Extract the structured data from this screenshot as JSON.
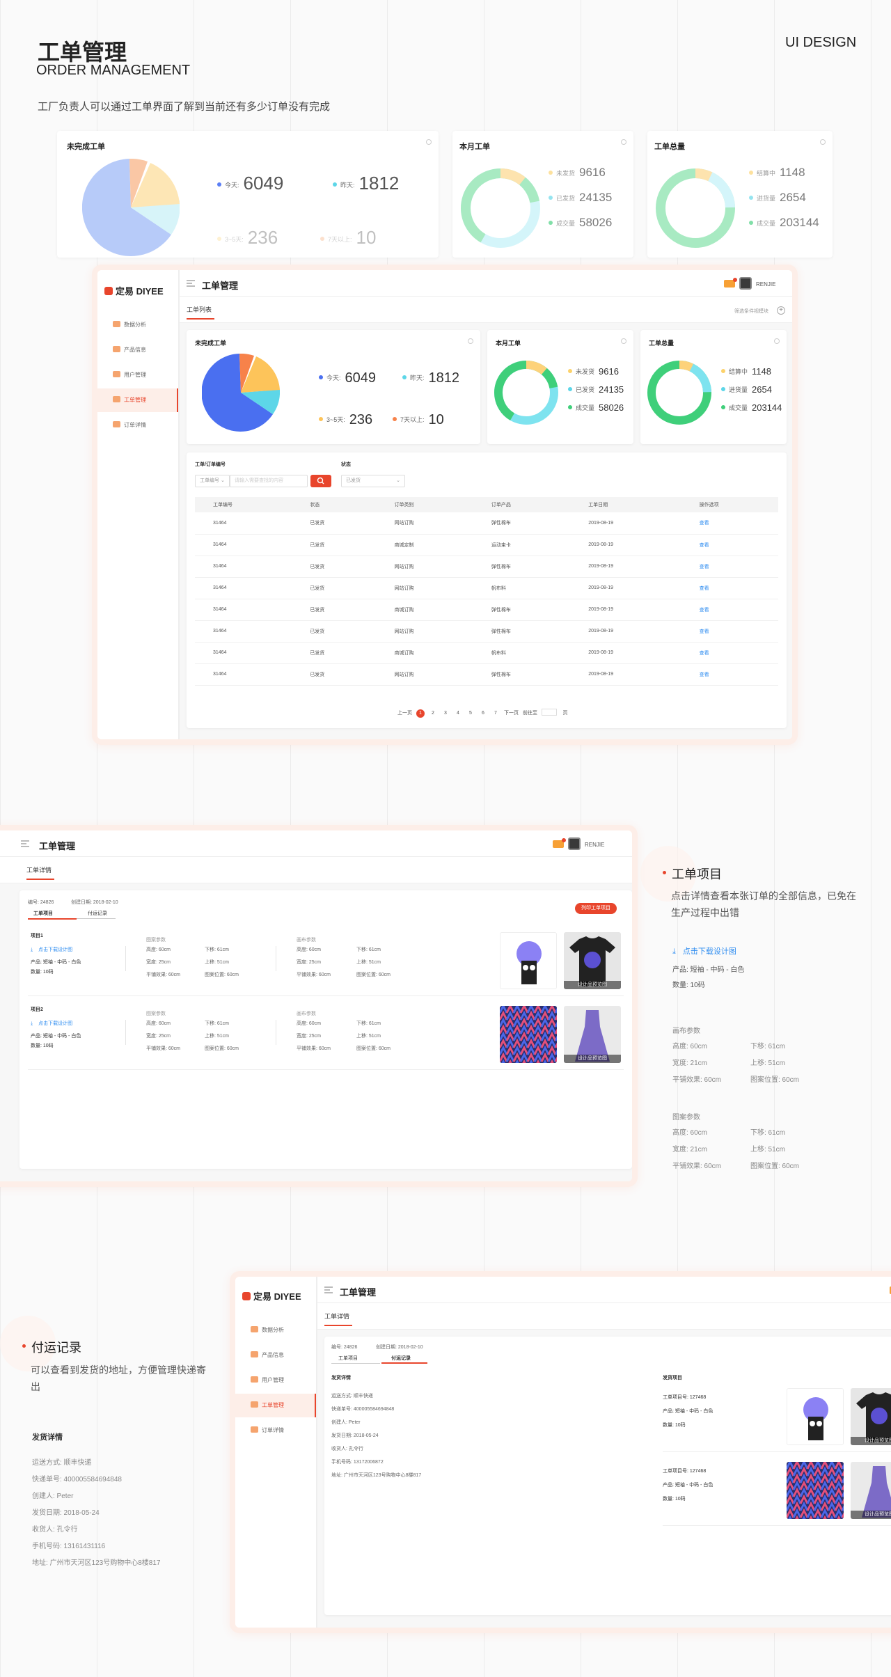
{
  "header": {
    "title_cn": "工单管理",
    "title_en": "ORDER MANAGEMENT",
    "ui_design": "UI DESIGN",
    "desc": "工厂负责人可以通过工单界面了解到当前还有多少订单没有完成"
  },
  "stats": {
    "unfinished_title": "未完成工单",
    "month_title": "本月工单",
    "total_title": "工单总量",
    "today_label": "今天:",
    "today_value": "6049",
    "yesterday_label": "昨天:",
    "yesterday_value": "1812",
    "d3_5_label": "3~5天:",
    "d3_5_value": "236",
    "d7_label": "7天以上:",
    "d7_value": "10",
    "month_items": [
      {
        "label": "未发货",
        "value": "9616",
        "color": "#fcd26b"
      },
      {
        "label": "已发货",
        "value": "24135",
        "color": "#5dd6e8"
      },
      {
        "label": "成交量",
        "value": "58026",
        "color": "#3fcf7a"
      }
    ],
    "total_items": [
      {
        "label": "结算中",
        "value": "1148",
        "color": "#fcd26b"
      },
      {
        "label": "进货量",
        "value": "2654",
        "color": "#5dd6e8"
      },
      {
        "label": "成交量",
        "value": "203144",
        "color": "#3fcf7a"
      }
    ]
  },
  "colors": {
    "accent": "#e8452c",
    "link": "#2d8cf0"
  },
  "app": {
    "logo": "定易 DIYEE",
    "page_title": "工单管理",
    "username": "RENJIE",
    "nav": [
      "数据分析",
      "产品信息",
      "用户管理",
      "工单管理",
      "订单详情"
    ],
    "tab_list": "工单列表",
    "filter_link": "筛选条件视模块",
    "search_label": "工单/订单编号",
    "status_label": "状态",
    "search_select": "工单编号",
    "search_placeholder": "请输入需要查找的内容",
    "status_select": "已发货",
    "columns": [
      "工单编号",
      "状态",
      "订单类别",
      "订单产品",
      "工单日期",
      "操作选项"
    ],
    "rows": [
      [
        "31464",
        "已发货",
        "网站订购",
        "弹性棉布",
        "2019-08-19",
        "查看"
      ],
      [
        "31464",
        "已发货",
        "商城定制",
        "运动束卡",
        "2019-08-19",
        "查看"
      ],
      [
        "31464",
        "已发货",
        "网站订购",
        "弹性棉布",
        "2019-08-19",
        "查看"
      ],
      [
        "31464",
        "已发货",
        "网站订购",
        "帆布料",
        "2019-08-19",
        "查看"
      ],
      [
        "31464",
        "已发货",
        "商城订购",
        "弹性棉布",
        "2019-08-19",
        "查看"
      ],
      [
        "31464",
        "已发货",
        "网站订购",
        "弹性棉布",
        "2019-08-19",
        "查看"
      ],
      [
        "31464",
        "已发货",
        "商城订购",
        "帆布料",
        "2019-08-19",
        "查看"
      ],
      [
        "31464",
        "已发货",
        "网站订购",
        "弹性棉布",
        "2019-08-19",
        "查看"
      ]
    ],
    "pager": {
      "prev": "上一页",
      "pages": [
        "1",
        "2",
        "3",
        "4",
        "5",
        "6",
        "7"
      ],
      "next": "下一页",
      "goto": "前往至",
      "page_unit": "页"
    }
  },
  "detail": {
    "tab_detail": "工单详情",
    "meta_no": "编号: 24826",
    "meta_date": "创建日期: 2018-02-10",
    "subtab_items": "工单项目",
    "subtab_ship": "付运记录",
    "print_btn": "列印工单项目",
    "item1": "项目1",
    "item2": "项目2",
    "download": "点击下载设计图",
    "product": "产品: 短袖 - 中码 - 白色",
    "qty": "数量: 10码",
    "param_a": "图案参数",
    "param_b": "画布参数",
    "p_height": "高度: 60cm",
    "p_width": "宽度: 25cm",
    "p_tile": "平铺效果: 60cm",
    "p_down": "下移: 61cm",
    "p_up": "上移: 51cm",
    "p_pos": "图案位置: 60cm",
    "mock_label": "设计品预览图"
  },
  "section_items": {
    "title": "工单项目",
    "desc": "点击详情查看本张订单的全部信息，已免在生产过程中出错",
    "download": "点击下载设计图",
    "product": "产品: 短袖 - 中码 - 白色",
    "qty": "数量: 10码",
    "canvas": "画布参数",
    "pattern": "图案参数",
    "height": "高度: 60cm",
    "width": "宽度: 21cm",
    "tile": "平铺效果: 60cm",
    "down": "下移: 61cm",
    "up": "上移: 51cm",
    "pos": "图案位置: 60cm"
  },
  "shipping": {
    "title": "付运记录",
    "desc": "可以查看到发货的地址，方便管理快递寄出",
    "head": "发货详情",
    "lines": [
      "运送方式: 顺丰快递",
      "快递单号: 400005584694848",
      "创建人: Peter",
      "发货日期: 2018-05-24",
      "收货人: 孔令行",
      "手机号码: 13161431116",
      "地址: 广州市天河区123号购物中心8楼817"
    ],
    "app_lines": [
      "运送方式: 顺丰快递",
      "快递单号: 400005584694848",
      "创建人: Peter",
      "发货日期: 2018-05-24",
      "收货人: 孔令行",
      "手机号码: 13172006872",
      "地址: 广州市天河区123号购物中心8楼817"
    ],
    "right_head": "发货项目",
    "item_no": "工单项目号: 127468",
    "product": "产品: 短袖 - 中码 - 白色",
    "qty": "数量: 10码"
  }
}
